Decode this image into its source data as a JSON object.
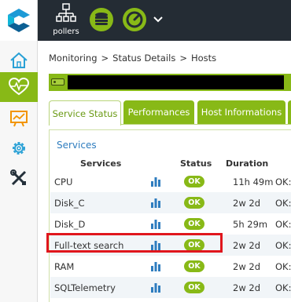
{
  "topbar": {
    "pollers_label": "pollers"
  },
  "breadcrumb": {
    "items": [
      "Monitoring",
      "Status Details",
      "Hosts"
    ],
    "separator": ">"
  },
  "tabs": [
    {
      "label": "Service Status",
      "active": true
    },
    {
      "label": "Performances",
      "active": false
    },
    {
      "label": "Host Informations",
      "active": false
    }
  ],
  "panel": {
    "title": "Services",
    "headers": {
      "services": "Services",
      "status": "Status",
      "duration": "Duration"
    },
    "rows": [
      {
        "name": "CPU",
        "status": "OK",
        "duration": "11h 49m",
        "output": "OK:"
      },
      {
        "name": "Disk_C",
        "status": "OK",
        "duration": "2w 2d",
        "output": "OK:"
      },
      {
        "name": "Disk_D",
        "status": "OK",
        "duration": "5h 29m",
        "output": "OK:"
      },
      {
        "name": "Full-text search",
        "status": "OK",
        "duration": "2w 2d",
        "output": "OK:"
      },
      {
        "name": "RAM",
        "status": "OK",
        "duration": "2w 2d",
        "output": "OK:"
      },
      {
        "name": "SQLTelemetry",
        "status": "OK",
        "duration": "2w 2d",
        "output": "OK:"
      }
    ]
  },
  "colors": {
    "accent": "#88b917",
    "topbar": "#242c34",
    "link": "#2f7dbf",
    "highlight": "#e0161d"
  }
}
